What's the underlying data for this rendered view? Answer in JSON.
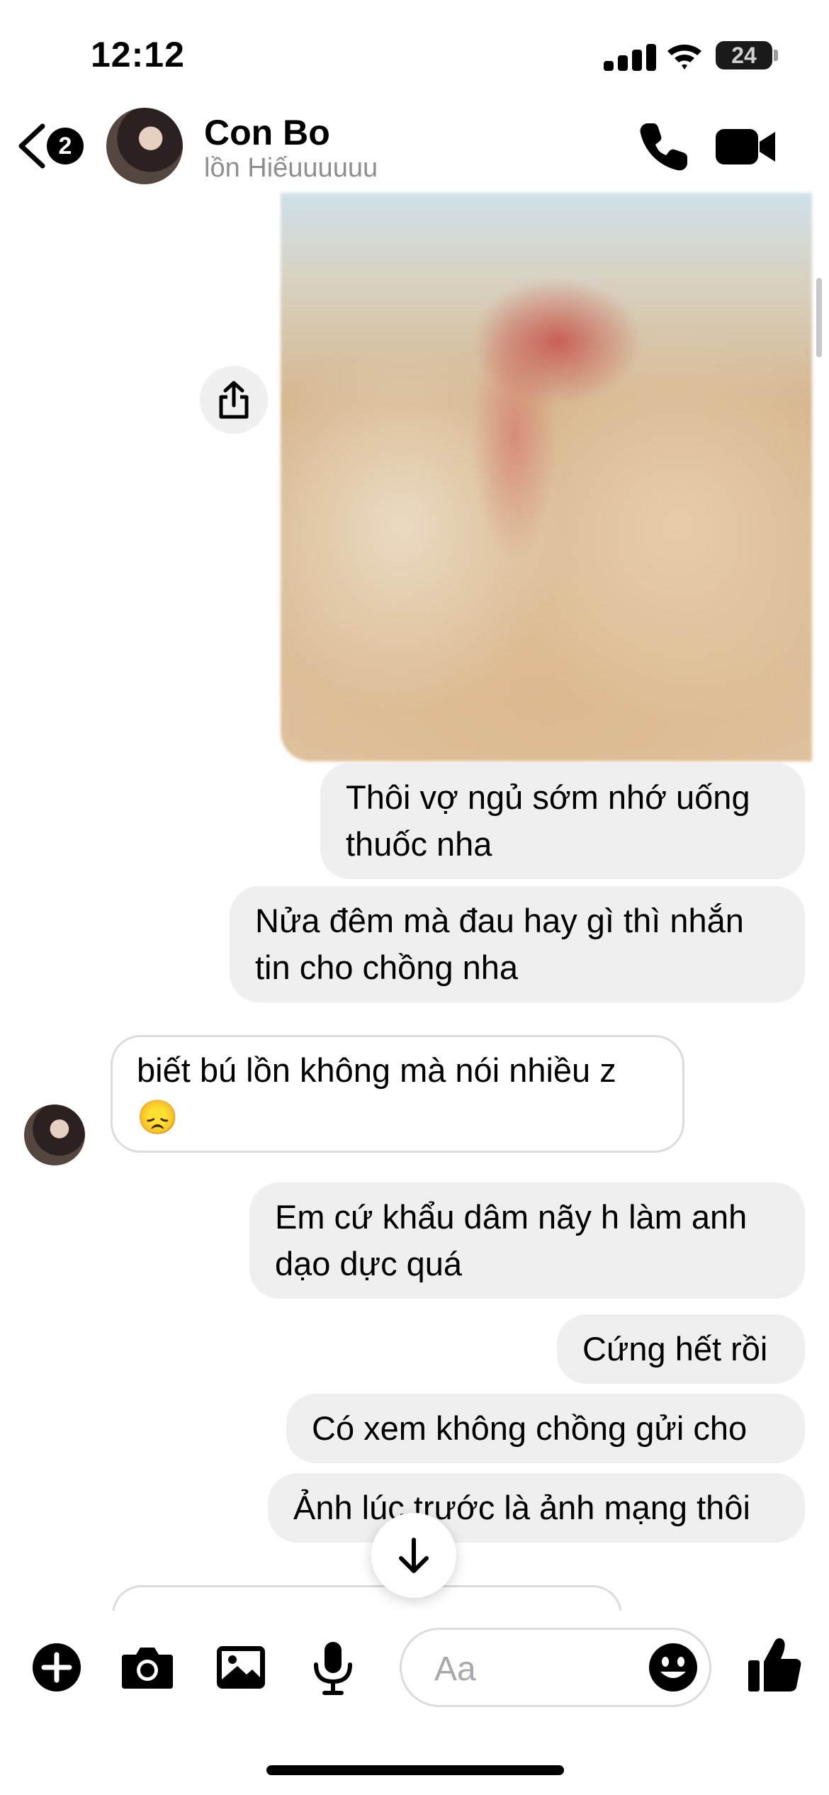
{
  "status_bar": {
    "time": "12:12",
    "battery": "24"
  },
  "header": {
    "back_badge": "2",
    "contact_name": "Con Bo",
    "contact_subtitle": "lồn Hiếuuuuuu"
  },
  "messages": [
    {
      "side": "out",
      "text": "Thôi vợ ngủ sớm nhớ uống thuốc nha"
    },
    {
      "side": "out",
      "text": "Nửa đêm mà đau hay gì thì nhắn tin cho chồng nha"
    },
    {
      "side": "in",
      "text": "biết bú lồn không mà nói nhiều z",
      "emoji": "😞"
    },
    {
      "side": "out",
      "text": "Em cứ khẩu dâm nãy h làm anh dạo dực quá"
    },
    {
      "side": "out",
      "text": "Cứng hết rồi"
    },
    {
      "side": "out",
      "text": "Có xem không chồng gửi cho"
    },
    {
      "side": "out",
      "text": "Ảnh lúc trước là ảnh mạng thôi"
    }
  ],
  "composer": {
    "placeholder": "Aa"
  },
  "icons": [
    "back-chevron-icon",
    "phone-icon",
    "video-camera-icon",
    "share-icon",
    "scroll-down-arrow-icon",
    "plus-icon",
    "camera-icon",
    "gallery-icon",
    "microphone-icon",
    "emoji-icon",
    "thumbs-up-icon"
  ]
}
